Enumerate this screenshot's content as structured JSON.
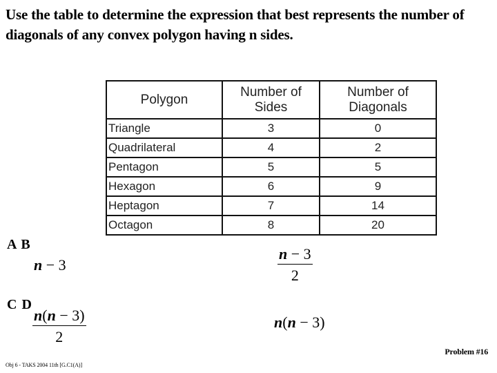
{
  "question": {
    "text": "Use the table to determine the expression that best represents the number of diagonals of any convex polygon having n sides."
  },
  "table": {
    "headers": [
      "Polygon",
      "Number of Sides",
      "Number of Diagonals"
    ],
    "header_lines": [
      [
        "Polygon"
      ],
      [
        "Number of",
        "Sides"
      ],
      [
        "Number of",
        "Diagonals"
      ]
    ],
    "rows": [
      {
        "polygon": "Triangle",
        "sides": "3",
        "diagonals": "0"
      },
      {
        "polygon": "Quadrilateral",
        "sides": "4",
        "diagonals": "2"
      },
      {
        "polygon": "Pentagon",
        "sides": "5",
        "diagonals": "5"
      },
      {
        "polygon": "Hexagon",
        "sides": "6",
        "diagonals": "9"
      },
      {
        "polygon": "Heptagon",
        "sides": "7",
        "diagonals": "14"
      },
      {
        "polygon": "Octagon",
        "sides": "8",
        "diagonals": "20"
      }
    ]
  },
  "choices": {
    "row1_letters": "A B",
    "row2_letters": "C D",
    "A": {
      "label": "A",
      "var": "n",
      "rest": " − 3",
      "expression": "n − 3"
    },
    "B": {
      "label": "B",
      "num_var": "n",
      "num_rest": " − 3",
      "den": "2",
      "expression": "(n − 3)/2"
    },
    "C": {
      "label": "C",
      "num_var1": "n",
      "num_mid": "(",
      "num_var2": "n",
      "num_rest": " − 3)",
      "den": "2",
      "expression": "n(n − 3)/2"
    },
    "D": {
      "label": "D",
      "var1": "n",
      "mid": "(",
      "var2": "n",
      "rest": " − 3)",
      "expression": "n(n − 3)"
    }
  },
  "footer": {
    "problem_number": "Problem #16",
    "objective": "Obj 6 - TAKS 2004 11th [G.C1(A)]"
  }
}
